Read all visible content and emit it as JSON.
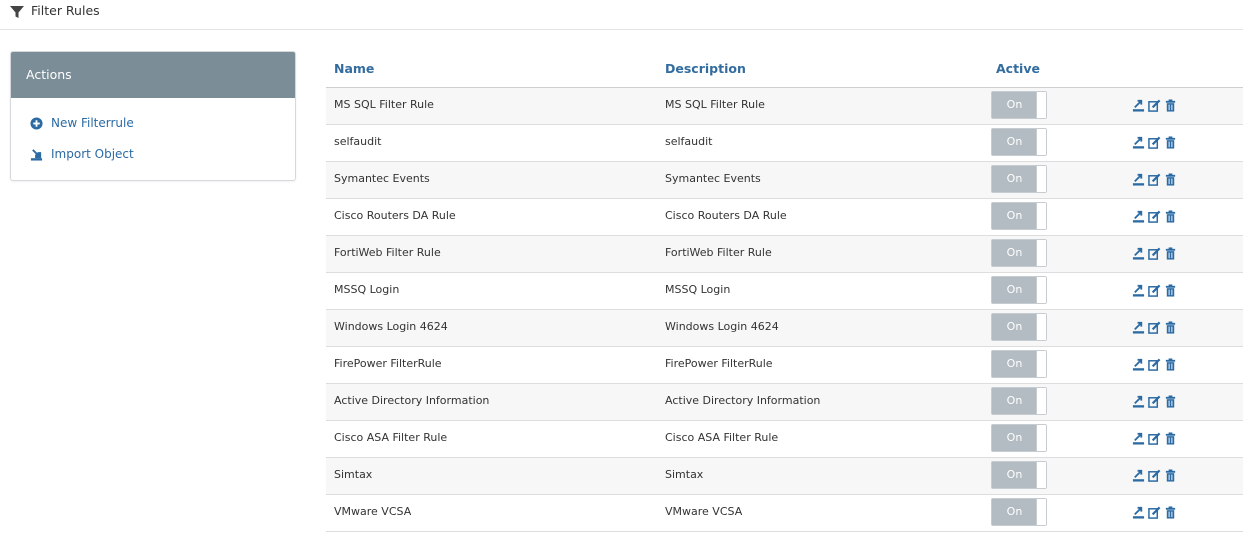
{
  "page": {
    "title": "Filter Rules"
  },
  "actions": {
    "heading": "Actions",
    "new_label": "New Filterrule",
    "import_label": "Import Object"
  },
  "table": {
    "columns": {
      "name": "Name",
      "description": "Description",
      "active": "Active"
    },
    "toggle_on_label": "On",
    "rows": [
      {
        "name": "MS SQL Filter Rule",
        "description": "MS SQL Filter Rule"
      },
      {
        "name": "selfaudit",
        "description": "selfaudit"
      },
      {
        "name": "Symantec Events",
        "description": "Symantec Events"
      },
      {
        "name": "Cisco Routers DA Rule",
        "description": "Cisco Routers DA Rule"
      },
      {
        "name": "FortiWeb Filter Rule",
        "description": "FortiWeb Filter Rule"
      },
      {
        "name": "MSSQ Login",
        "description": "MSSQ Login"
      },
      {
        "name": "Windows Login 4624",
        "description": "Windows Login 4624"
      },
      {
        "name": "FirePower FilterRule",
        "description": "FirePower FilterRule"
      },
      {
        "name": "Active Directory Information",
        "description": "Active Directory Information"
      },
      {
        "name": "Cisco ASA Filter Rule",
        "description": "Cisco ASA Filter Rule"
      },
      {
        "name": "Simtax",
        "description": "Simtax"
      },
      {
        "name": "VMware VCSA",
        "description": "VMware VCSA"
      }
    ]
  },
  "icons": {
    "header": "funnel-icon",
    "new": "plus-circle-icon",
    "import": "import-icon",
    "row_actions": [
      "export-icon",
      "edit-icon",
      "trash-icon"
    ]
  },
  "colors": {
    "link": "#2b6aa3",
    "header_text": "#336c9f",
    "panel_head": "#7b8d97",
    "toggle_on": "#b3bcc2"
  }
}
